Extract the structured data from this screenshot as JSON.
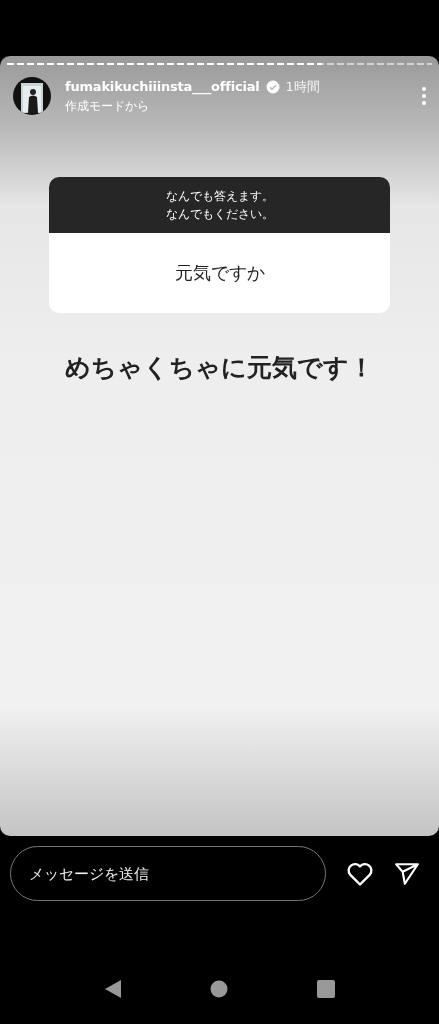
{
  "story": {
    "progress": {
      "level": 0.74
    },
    "user": {
      "name": "fumakikuchiiinsta___official",
      "time": "1時間",
      "subtitle": "作成モードから"
    },
    "question_box": {
      "prompt": [
        "なんでも答えます。",
        "なんでもください。"
      ],
      "question": "元気ですか"
    },
    "answer": "めちゃくちゃに元気です！"
  },
  "reply_bar": {
    "placeholder": "メッセージを送信"
  }
}
